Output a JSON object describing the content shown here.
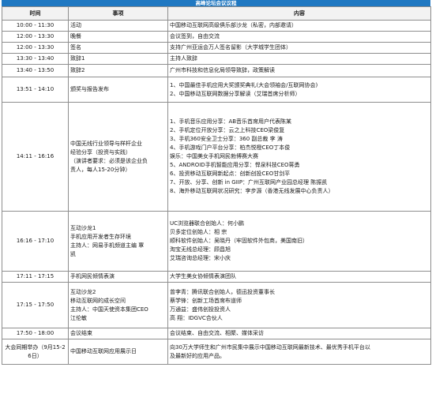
{
  "page_title": "高峰论坛会议议程",
  "headers": {
    "time": "时间",
    "event": "事项",
    "content": "内容"
  },
  "rows": [
    {
      "time": "10:00 - 11:30",
      "event": [
        "活动"
      ],
      "content": [
        "中国移动互联网高级俱乐部沙龙（私密，内部邀请）"
      ]
    },
    {
      "time": "12:00 - 13:30",
      "event": [
        "晚餐"
      ],
      "content": [
        "会议签到，自由交流"
      ]
    },
    {
      "time": "12:00 - 13:30",
      "event": [
        "签名"
      ],
      "content": [
        "支持广州亚运会万人签名留影（大学城学生团体）"
      ]
    },
    {
      "time": "13:30 - 13:40",
      "event": [
        "致辞1"
      ],
      "content": [
        "主持人致辞"
      ]
    },
    {
      "time": "13:40 - 13:50",
      "event": [
        "致辞2"
      ],
      "content": [
        "广州市科技和信息化局领导致辞，政策解读"
      ]
    },
    {
      "time": "13:51 - 14:10",
      "event": [
        "颁奖与报告发布"
      ],
      "content": [
        "1、中国最佳手机应用大奖颁奖典礼(大会领袖会/互联网协会)",
        "2、中国移动互联网数据分享解读（艾瑞首席分析师）"
      ]
    },
    {
      "time": "14:11 - 16:16",
      "event": [
        "中国无线行业领导与样杆企业",
        "经验分享（投资与实践）",
        "（演讲者要求：必须是该企业负",
        "责人，每人15-20分钟）"
      ],
      "content": [
        "1、手机音乐应用分享：AB音乐首席用户代表陈某",
        "2、手机定位开放分享：云之上科技CEO梁俊复",
        "3、手机360安全卫士分享：360 副总裁 李 涛",
        "4、手机游戏门户平台分享：柏杰悦橙CEO丁本俊",
        "娱乐：中国美女手机网民勃博赛大赛",
        "5、ANDROID手机智能应用分享：悍泉科技CEO蒋勇",
        "6、投资移动互联网新起点：创新创投CEO甘剑平",
        "7、开放、分享、创新 in GIIP：广州互联网产业园总经理 陈振凯",
        "8、海外移动互联网状况研究：李步源（香港无线发展中心负责人）"
      ]
    },
    {
      "time": "16:16 - 17:10",
      "event": [
        "互动沙龙1",
        "手机应用开发者生存环境",
        "主持人：网易手机频道主编 覃",
        "凯"
      ],
      "content": [
        "UC浏览器联合创始人：何小鹏",
        "贝多定位创始人：相 宗",
        "顺科软件创始人：吴晓丹（牢固软件外包商，美国南旧）",
        "淘宝无线总经理：顾昌旭",
        "艾瑞咨询总经理：宋小庆"
      ]
    },
    {
      "time": "17:11 - 17:15",
      "event": [
        "手机网民倾情表演"
      ],
      "content": [
        "大学生美女协倾情表演团队"
      ]
    },
    {
      "time": "17:15 - 17:50",
      "event": [
        "互动沙龙2",
        "移动互联网的成长空间",
        "主持人：中国天使资本集团CEO",
        "江伦敏"
      ],
      "content": [
        "曾李青：腾讯联合创始人，德迅投资董事长",
        "蔡学锋：创新工场首席布道师",
        "万通益：盛伟创投投资人",
        "高 翔：IDGVC合伙人"
      ]
    },
    {
      "time": "17:50 - 18:00",
      "event": [
        "会议结束"
      ],
      "content": [
        "会议结束、自由交流、相聚、媒体采访"
      ]
    },
    {
      "time": "大会同期举办（9月15-26日）",
      "event": [
        "中国移动互联网应用展示日"
      ],
      "content": [
        "向30万大学师生和广州市民集中展示中国移动互联网最新技术、最优秀手机平台以",
        "及最新好的应用产品。"
      ]
    }
  ]
}
